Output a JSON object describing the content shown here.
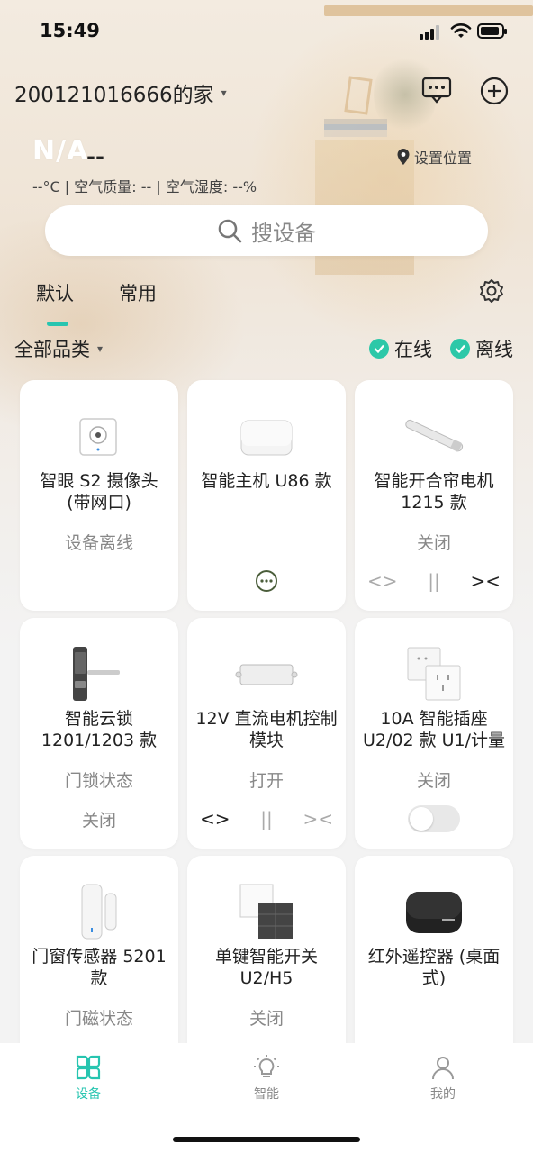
{
  "status_bar": {
    "time": "15:49"
  },
  "header": {
    "home_name": "200121016666的家",
    "chevron": "⌄",
    "message_icon": "message-icon",
    "add_icon": "add-icon"
  },
  "weather": {
    "condition": "N/A",
    "dash": "--",
    "details": "--°C | 空气质量: -- | 空气湿度: --%",
    "location_label": "设置位置"
  },
  "search": {
    "placeholder": "搜设备"
  },
  "tabs": [
    {
      "label": "默认",
      "active": true
    },
    {
      "label": "常用",
      "active": false
    }
  ],
  "filter": {
    "category": "全部品类",
    "online_label": "在线",
    "offline_label": "离线",
    "check_color": "#2cc8a8"
  },
  "devices": [
    {
      "name": "智眼 S2 摄像头 (带网口)",
      "status": "设备离线",
      "extra": ""
    },
    {
      "name": "智能主机 U86 款",
      "status": "",
      "extra": ""
    },
    {
      "name": "智能开合帘电机 1215 款",
      "status": "关闭",
      "extra": ""
    },
    {
      "name": "智能云锁 1201/1203 款",
      "status": "门锁状态",
      "extra": "关闭"
    },
    {
      "name": "12V 直流电机控制模块",
      "status": "打开",
      "extra": ""
    },
    {
      "name": "10A 智能插座 U2/02 款 U1/计量",
      "status": "关闭",
      "extra": ""
    },
    {
      "name": "门窗传感器 5201 款",
      "status": "门磁状态",
      "extra": ""
    },
    {
      "name": "单键智能开关 U2/H5",
      "status": "关闭",
      "extra": ""
    },
    {
      "name": "红外遥控器 (桌面式)",
      "status": "",
      "extra": ""
    }
  ],
  "curtain_controls": {
    "open": "<>",
    "pause": "||",
    "close": "><"
  },
  "tabbar": [
    {
      "label": "设备",
      "icon": "devices-icon",
      "active": true
    },
    {
      "label": "智能",
      "icon": "bulb-icon",
      "active": false
    },
    {
      "label": "我的",
      "icon": "profile-icon",
      "active": false
    }
  ],
  "colors": {
    "accent": "#27c5b0"
  }
}
